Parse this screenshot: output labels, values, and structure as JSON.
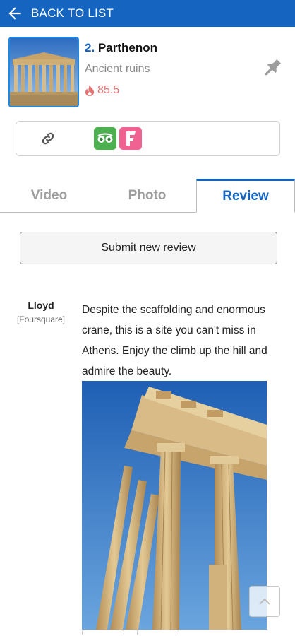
{
  "header": {
    "back_label": "BACK TO LIST",
    "back_icon": "arrow-left-icon"
  },
  "place": {
    "number": "2.",
    "name": "Parthenon",
    "category": "Ancient ruins",
    "score": "85.5",
    "score_icon": "flame-icon",
    "pin_icon": "pushpin-icon"
  },
  "links": {
    "icons": [
      "link-icon",
      "tripadvisor-icon",
      "foursquare-icon"
    ]
  },
  "tabs": [
    {
      "label": "Video"
    },
    {
      "label": "Photo"
    },
    {
      "label": "Review"
    }
  ],
  "active_tab": "Review",
  "submit_label": "Submit new review",
  "review": {
    "author": "Lloyd",
    "source": "[Foursquare]",
    "text": "Despite the scaffolding and enormous crane, this is a site you can't miss in Athens. Enjoy the climb up the hill and admire the beauty."
  },
  "colors": {
    "brand": "#1565c0",
    "score": "#e57373",
    "tripadvisor": "#4caf50",
    "foursquare": "#f06292"
  }
}
